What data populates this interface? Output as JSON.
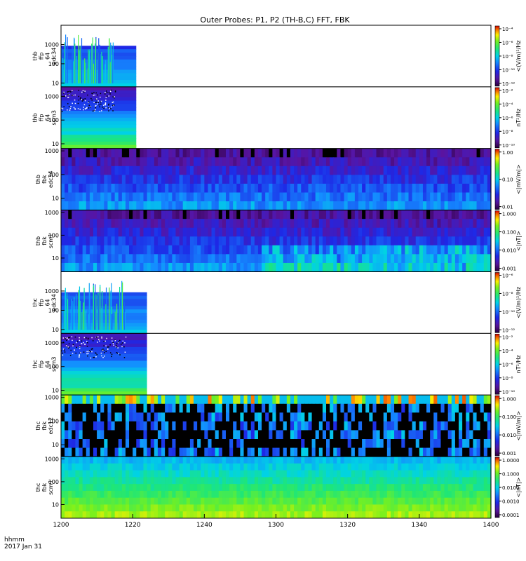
{
  "title": "Outer Probes: P1, P2 (TH-B,C) FFT, FBK",
  "footer": {
    "line1": "hhmm",
    "line2": "2017 Jan 31"
  },
  "chart_data": {
    "type": "heatmap",
    "x": {
      "ticks": [
        "1200",
        "1220",
        "1240",
        "1300",
        "1320",
        "1340",
        "1400"
      ],
      "range_minutes": [
        0,
        120
      ]
    },
    "panels": [
      {
        "id": "thb-ffp-e34",
        "ylabel": [
          "thb",
          "ffp",
          "64",
          "edc34"
        ],
        "yticks": [
          "1000",
          "100",
          "10"
        ],
        "ylog": [
          0.8,
          4.0
        ],
        "cb_label": "<(V/m)²/Hz",
        "cb_ticks": [
          "10⁻⁴",
          "10⁻⁶",
          "10⁻⁸",
          "10⁻¹⁰",
          "10⁻¹²"
        ],
        "data_end_minute": 21,
        "style": "spiky",
        "bg": "#ffffff"
      },
      {
        "id": "thb-ffp-scm3",
        "ylabel": [
          "thb",
          "ffp",
          "64",
          "scm3"
        ],
        "yticks": [
          "1000",
          "100",
          "10"
        ],
        "ylog": [
          0.8,
          3.4
        ],
        "cb_label": "nT²/Hz",
        "cb_ticks": [
          "10⁻²",
          "10⁻⁴",
          "10⁻⁶",
          "10⁻⁸",
          "10⁻¹⁰"
        ],
        "data_end_minute": 21,
        "style": "scm",
        "bg": "#ffffff"
      },
      {
        "id": "thb-fbk-e34",
        "ylabel": [
          "thb",
          "fbk",
          "edc34"
        ],
        "yticks": [
          "1000",
          "100",
          "10"
        ],
        "ylog": [
          0.5,
          3.1
        ],
        "cb_label": "<|mV/m|>",
        "cb_ticks": [
          "1.00",
          "0.10",
          "0.01"
        ],
        "data_end_minute": 120,
        "style": "fbkE",
        "bg": "#000000"
      },
      {
        "id": "thb-fbk-scm1",
        "ylabel": [
          "thb",
          "fbk",
          "scm1"
        ],
        "yticks": [
          "1000",
          "100",
          "10"
        ],
        "ylog": [
          0.4,
          3.1
        ],
        "cb_label": "<|nT|>",
        "cb_ticks": [
          "1.000",
          "0.100",
          "0.010",
          "0.001"
        ],
        "data_end_minute": 120,
        "style": "fbkB",
        "bg": "#000000"
      },
      {
        "id": "thc-ffp-e34",
        "ylabel": [
          "thc",
          "ffp",
          "64",
          "edc34"
        ],
        "yticks": [
          "1000",
          "100",
          "10"
        ],
        "ylog": [
          0.8,
          4.0
        ],
        "cb_label": "<(V/m)²/Hz",
        "cb_ticks": [
          "10⁻⁶",
          "10⁻⁸",
          "10⁻¹⁰",
          "10⁻¹²"
        ],
        "data_end_minute": 24,
        "style": "spiky",
        "bg": "#ffffff"
      },
      {
        "id": "thc-ffp-scm3",
        "ylabel": [
          "thc",
          "ffp",
          "64",
          "scm3"
        ],
        "yticks": [
          "1000",
          "100",
          "10"
        ],
        "ylog": [
          0.8,
          3.4
        ],
        "cb_label": "nT²/Hz",
        "cb_ticks": [
          "10⁻²",
          "10⁻⁴",
          "10⁻⁶",
          "10⁻⁸",
          "10⁻¹⁰"
        ],
        "data_end_minute": 24,
        "style": "scm",
        "bg": "#ffffff"
      },
      {
        "id": "thc-fbk-e12",
        "ylabel": [
          "thc",
          "fbk",
          "edc12"
        ],
        "yticks": [
          "1000",
          "100",
          "10"
        ],
        "ylog": [
          0.5,
          3.1
        ],
        "cb_label": "<|mV/m|>",
        "cb_ticks": [
          "1.000",
          "0.100",
          "0.010",
          "0.001"
        ],
        "data_end_minute": 120,
        "style": "fbkE2",
        "bg": "#000000"
      },
      {
        "id": "thc-fbk-scm1",
        "ylabel": [
          "thc",
          "fbk",
          "scm1"
        ],
        "yticks": [
          "1000",
          "100",
          "10"
        ],
        "ylog": [
          0.4,
          3.1
        ],
        "cb_label": "<|nT|>",
        "cb_ticks": [
          "1.0000",
          "0.1000",
          "0.0100",
          "0.0010",
          "0.0001"
        ],
        "data_end_minute": 120,
        "style": "fbkB2",
        "bg": "#000000"
      }
    ]
  }
}
